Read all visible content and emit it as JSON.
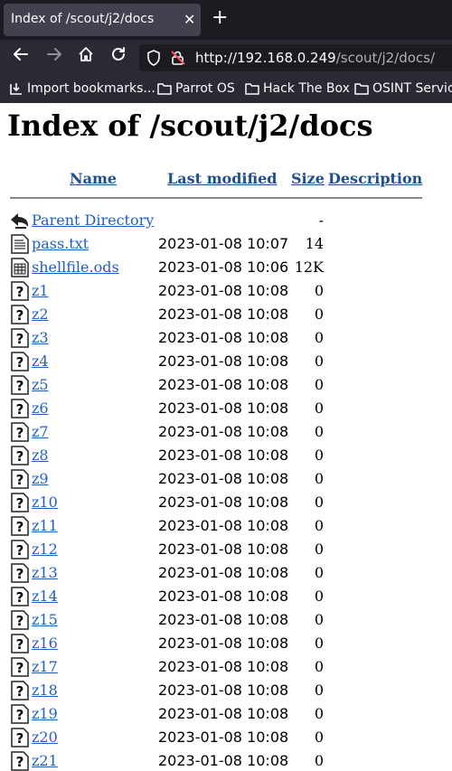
{
  "browser": {
    "tab_title": "Index of /scout/j2/docs",
    "tab_close": "✕",
    "new_tab": "+",
    "url_host": "http://192.168.0.249",
    "url_path": "/scout/j2/docs/",
    "bookmarks": [
      {
        "label": "Import bookmarks...",
        "icon": "import-icon"
      },
      {
        "label": "Parrot OS",
        "icon": "folder-icon"
      },
      {
        "label": "Hack The Box",
        "icon": "folder-icon"
      },
      {
        "label": "OSINT Servic",
        "icon": "folder-icon"
      }
    ]
  },
  "page": {
    "title": "Index of /scout/j2/docs",
    "columns": {
      "name": "Name",
      "modified": "Last modified",
      "size": "Size",
      "description": "Description"
    },
    "rows": [
      {
        "name": "Parent Directory",
        "modified": "",
        "size": "-",
        "icon": "back-arrow-icon"
      },
      {
        "name": "pass.txt",
        "modified": "2023-01-08 10:07",
        "size": "14",
        "icon": "text-file-icon"
      },
      {
        "name": "shellfile.ods",
        "modified": "2023-01-08 10:06",
        "size": "12K",
        "icon": "spreadsheet-file-icon"
      },
      {
        "name": "z1",
        "modified": "2023-01-08 10:08",
        "size": "0",
        "icon": "unknown-file-icon"
      },
      {
        "name": "z2",
        "modified": "2023-01-08 10:08",
        "size": "0",
        "icon": "unknown-file-icon"
      },
      {
        "name": "z3",
        "modified": "2023-01-08 10:08",
        "size": "0",
        "icon": "unknown-file-icon"
      },
      {
        "name": "z4",
        "modified": "2023-01-08 10:08",
        "size": "0",
        "icon": "unknown-file-icon"
      },
      {
        "name": "z5",
        "modified": "2023-01-08 10:08",
        "size": "0",
        "icon": "unknown-file-icon"
      },
      {
        "name": "z6",
        "modified": "2023-01-08 10:08",
        "size": "0",
        "icon": "unknown-file-icon"
      },
      {
        "name": "z7",
        "modified": "2023-01-08 10:08",
        "size": "0",
        "icon": "unknown-file-icon"
      },
      {
        "name": "z8",
        "modified": "2023-01-08 10:08",
        "size": "0",
        "icon": "unknown-file-icon"
      },
      {
        "name": "z9",
        "modified": "2023-01-08 10:08",
        "size": "0",
        "icon": "unknown-file-icon"
      },
      {
        "name": "z10",
        "modified": "2023-01-08 10:08",
        "size": "0",
        "icon": "unknown-file-icon"
      },
      {
        "name": "z11",
        "modified": "2023-01-08 10:08",
        "size": "0",
        "icon": "unknown-file-icon"
      },
      {
        "name": "z12",
        "modified": "2023-01-08 10:08",
        "size": "0",
        "icon": "unknown-file-icon"
      },
      {
        "name": "z13",
        "modified": "2023-01-08 10:08",
        "size": "0",
        "icon": "unknown-file-icon"
      },
      {
        "name": "z14",
        "modified": "2023-01-08 10:08",
        "size": "0",
        "icon": "unknown-file-icon"
      },
      {
        "name": "z15",
        "modified": "2023-01-08 10:08",
        "size": "0",
        "icon": "unknown-file-icon"
      },
      {
        "name": "z16",
        "modified": "2023-01-08 10:08",
        "size": "0",
        "icon": "unknown-file-icon"
      },
      {
        "name": "z17",
        "modified": "2023-01-08 10:08",
        "size": "0",
        "icon": "unknown-file-icon"
      },
      {
        "name": "z18",
        "modified": "2023-01-08 10:08",
        "size": "0",
        "icon": "unknown-file-icon"
      },
      {
        "name": "z19",
        "modified": "2023-01-08 10:08",
        "size": "0",
        "icon": "unknown-file-icon"
      },
      {
        "name": "z20",
        "modified": "2023-01-08 10:08",
        "size": "0",
        "icon": "unknown-file-icon"
      },
      {
        "name": "z21",
        "modified": "2023-01-08 10:08",
        "size": "0",
        "icon": "unknown-file-icon"
      }
    ]
  }
}
